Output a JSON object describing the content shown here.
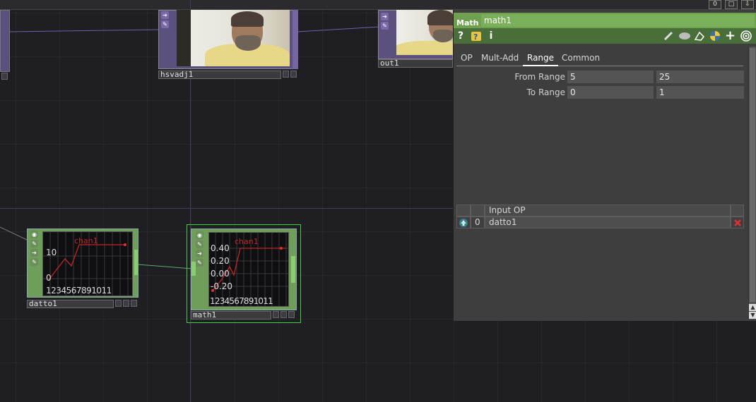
{
  "window_buttons": {
    "minimize": "0",
    "maximize": "□",
    "pin": "⇩"
  },
  "nodes": {
    "hsvadj": {
      "name": "hsvadj1"
    },
    "out": {
      "name": "out1"
    },
    "datto": {
      "name": "datto1",
      "channel": "chan1",
      "y_ticks": [
        "10",
        "0"
      ],
      "x_ticks": [
        "1",
        "2",
        "3",
        "4",
        "5",
        "6",
        "7",
        "8",
        "9",
        "10",
        "11"
      ]
    },
    "math": {
      "name": "math1",
      "channel": "chan1",
      "y_ticks": [
        "0.40",
        "0.20",
        "0.00",
        "-0.20"
      ],
      "x_ticks": [
        "1",
        "2",
        "3",
        "4",
        "5",
        "6",
        "7",
        "8",
        "9",
        "10",
        "11"
      ]
    }
  },
  "panel": {
    "op_type": "Math",
    "op_name": "math1",
    "toolbar": [
      "help-icon",
      "python-help-icon",
      "info-icon",
      "edit-icon",
      "comment-icon",
      "clone-icon",
      "python-icon",
      "add-icon",
      "target-icon"
    ],
    "toolbar_glyphs": {
      "help": "?",
      "info": "i",
      "add": "+"
    },
    "tabs": [
      "OP",
      "Mult-Add",
      "Range",
      "Common"
    ],
    "active_tab": "Range",
    "params": [
      {
        "label": "From Range",
        "v1": "5",
        "v2": "25"
      },
      {
        "label": "To Range",
        "v1": "0",
        "v2": "1"
      }
    ],
    "inputs_header": "Input OP",
    "inputs": [
      {
        "index": "0",
        "op": "datto1"
      }
    ],
    "colors": {
      "title_bar": "#6fa050",
      "toolbar": "#4a6e3a",
      "bg": "#3e3e3e"
    }
  }
}
